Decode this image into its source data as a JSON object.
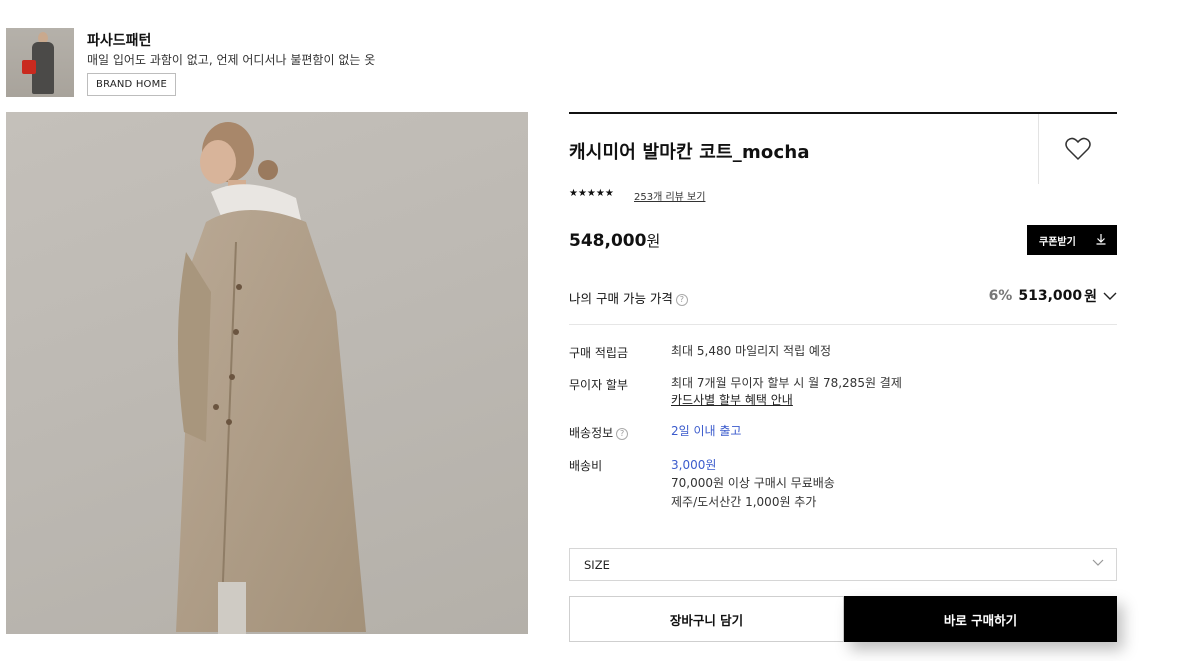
{
  "brand": {
    "name": "파사드패턴",
    "slogan": "매일 입어도 과함이 없고, 언제 어디서나 불편함이 없는 옷",
    "home_button": "BRAND HOME"
  },
  "product": {
    "title": "캐시미어 발마칸 코트_mocha",
    "stars": "★★★★★",
    "rating": 5,
    "review_link": "253개 리뷰 보기",
    "price_amount": "548,000",
    "price_unit": "원",
    "coupon_button": "쿠폰받기"
  },
  "my_price": {
    "label": "나의 구매 가능 가격",
    "help": "?",
    "rate": "6%",
    "amount": "513,000",
    "unit": "원"
  },
  "info_rows": {
    "points_label": "구매 적립금",
    "points_value": "최대 5,480 마일리지 적립 예정",
    "installment_label": "무이자 할부",
    "installment_value": "최대 7개월 무이자 할부 시 월 78,285원 결제",
    "installment_link": "카드사별 할부 혜택 안내",
    "shipping_label": "배송정보",
    "shipping_help": "?",
    "shipping_value": "2일 이내 출고",
    "fee_label": "배송비",
    "fee_value": "3,000원",
    "fee_note1": "70,000원 이상 구매시 무료배송",
    "fee_note2": "제주/도서산간 1,000원 추가"
  },
  "options": {
    "size_placeholder": "SIZE"
  },
  "actions": {
    "cart": "장바구니 담기",
    "buy": "바로 구매하기"
  },
  "colors": {
    "accent_blue": "#3b5bcc",
    "black": "#000000"
  }
}
